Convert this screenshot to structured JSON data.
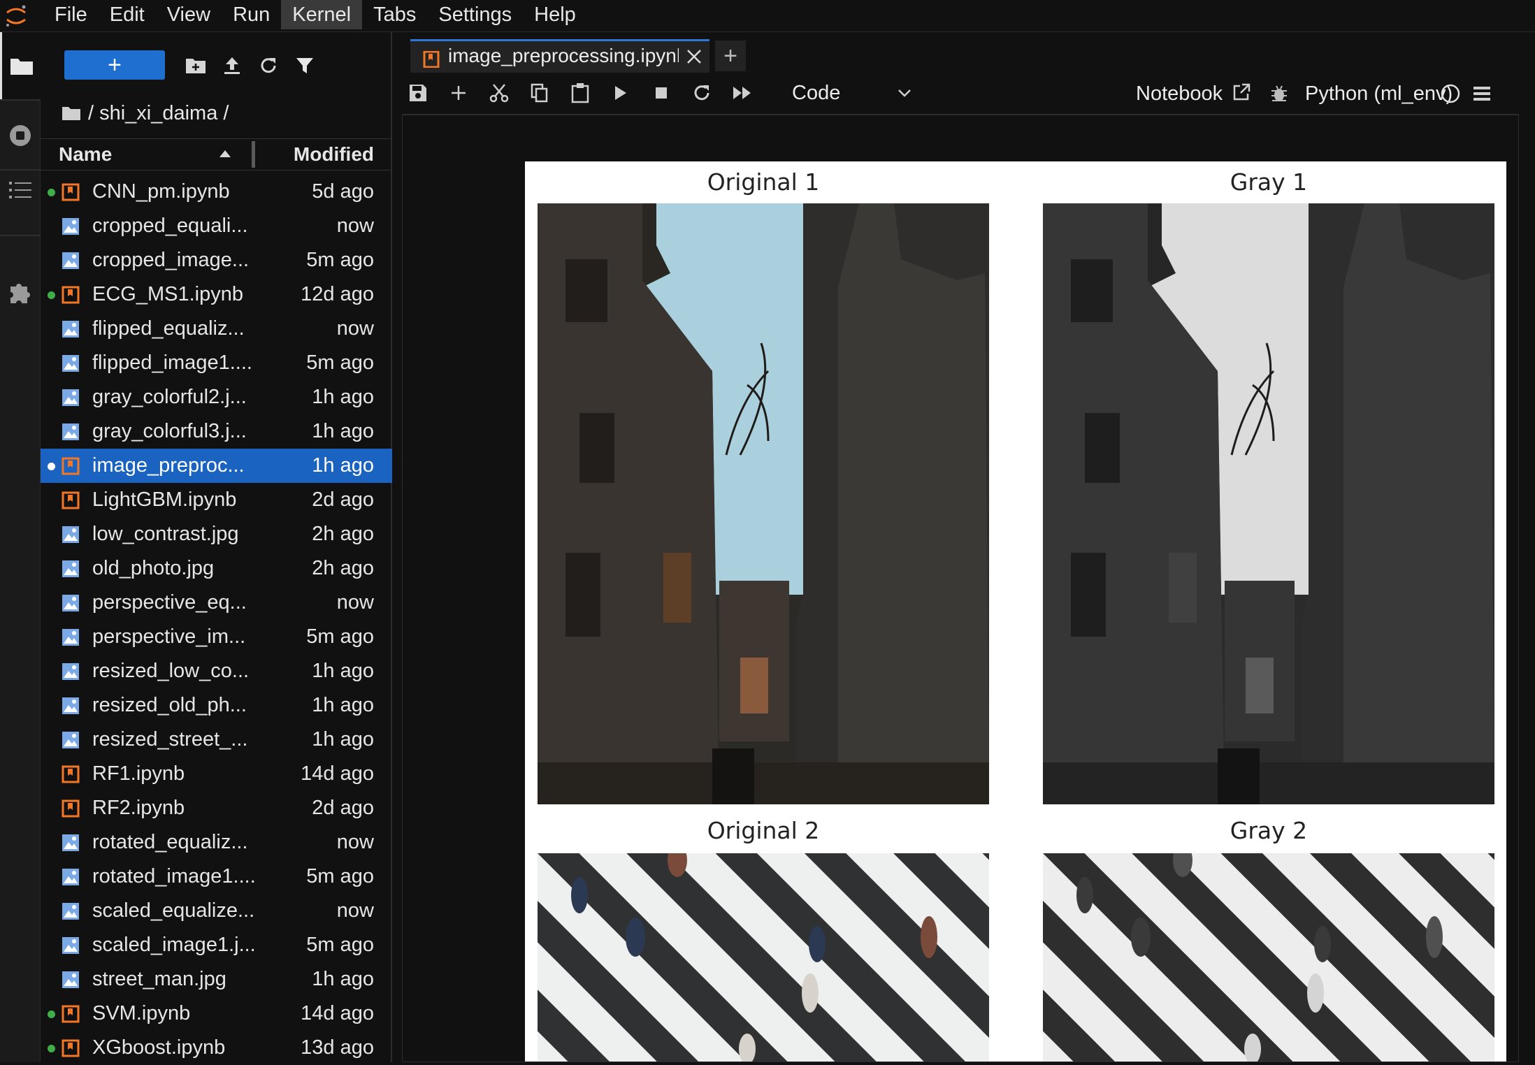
{
  "menubar": {
    "items": [
      "File",
      "Edit",
      "View",
      "Run",
      "Kernel",
      "Tabs",
      "Settings",
      "Help"
    ],
    "active": "Kernel"
  },
  "filebrowser": {
    "new_button_label": "+",
    "breadcrumb": {
      "root": "/",
      "folder": "shi_xi_daima",
      "trailing": "/"
    },
    "columns": {
      "name": "Name",
      "modified": "Modified"
    },
    "files": [
      {
        "name": "CNN_pm.ipynb",
        "modified": "5d ago",
        "type": "notebook",
        "running": true
      },
      {
        "name": "cropped_equali...",
        "modified": "now",
        "type": "image",
        "running": false
      },
      {
        "name": "cropped_image...",
        "modified": "5m ago",
        "type": "image",
        "running": false
      },
      {
        "name": "ECG_MS1.ipynb",
        "modified": "12d ago",
        "type": "notebook",
        "running": true
      },
      {
        "name": "flipped_equaliz...",
        "modified": "now",
        "type": "image",
        "running": false
      },
      {
        "name": "flipped_image1....",
        "modified": "5m ago",
        "type": "image",
        "running": false
      },
      {
        "name": "gray_colorful2.j...",
        "modified": "1h ago",
        "type": "image",
        "running": false
      },
      {
        "name": "gray_colorful3.j...",
        "modified": "1h ago",
        "type": "image",
        "running": false
      },
      {
        "name": "image_preproc...",
        "modified": "1h ago",
        "type": "notebook",
        "running": true,
        "selected": true
      },
      {
        "name": "LightGBM.ipynb",
        "modified": "2d ago",
        "type": "notebook",
        "running": false
      },
      {
        "name": "low_contrast.jpg",
        "modified": "2h ago",
        "type": "image",
        "running": false
      },
      {
        "name": "old_photo.jpg",
        "modified": "2h ago",
        "type": "image",
        "running": false
      },
      {
        "name": "perspective_eq...",
        "modified": "now",
        "type": "image",
        "running": false
      },
      {
        "name": "perspective_im...",
        "modified": "5m ago",
        "type": "image",
        "running": false
      },
      {
        "name": "resized_low_co...",
        "modified": "1h ago",
        "type": "image",
        "running": false
      },
      {
        "name": "resized_old_ph...",
        "modified": "1h ago",
        "type": "image",
        "running": false
      },
      {
        "name": "resized_street_...",
        "modified": "1h ago",
        "type": "image",
        "running": false
      },
      {
        "name": "RF1.ipynb",
        "modified": "14d ago",
        "type": "notebook",
        "running": false
      },
      {
        "name": "RF2.ipynb",
        "modified": "2d ago",
        "type": "notebook",
        "running": false
      },
      {
        "name": "rotated_equaliz...",
        "modified": "now",
        "type": "image",
        "running": false
      },
      {
        "name": "rotated_image1....",
        "modified": "5m ago",
        "type": "image",
        "running": false
      },
      {
        "name": "scaled_equalize...",
        "modified": "now",
        "type": "image",
        "running": false
      },
      {
        "name": "scaled_image1.j...",
        "modified": "5m ago",
        "type": "image",
        "running": false
      },
      {
        "name": "street_man.jpg",
        "modified": "1h ago",
        "type": "image",
        "running": false
      },
      {
        "name": "SVM.ipynb",
        "modified": "14d ago",
        "type": "notebook",
        "running": true
      },
      {
        "name": "XGboost.ipynb",
        "modified": "13d ago",
        "type": "notebook",
        "running": true
      }
    ]
  },
  "tab": {
    "label": "image_preprocessing.ipynb",
    "new_tab": "+"
  },
  "notebook_toolbar": {
    "cell_type": "Code",
    "notebook_label": "Notebook",
    "kernel": "Python (ml_env)"
  },
  "output": {
    "titles": [
      "Original 1",
      "Gray 1",
      "Original 2",
      "Gray 2"
    ]
  },
  "colors": {
    "background": "#111111",
    "accent": "#1a63c0",
    "running_dot": "#3fae49",
    "notebook_icon": "#f37726",
    "image_icon": "#7aa9e6"
  }
}
